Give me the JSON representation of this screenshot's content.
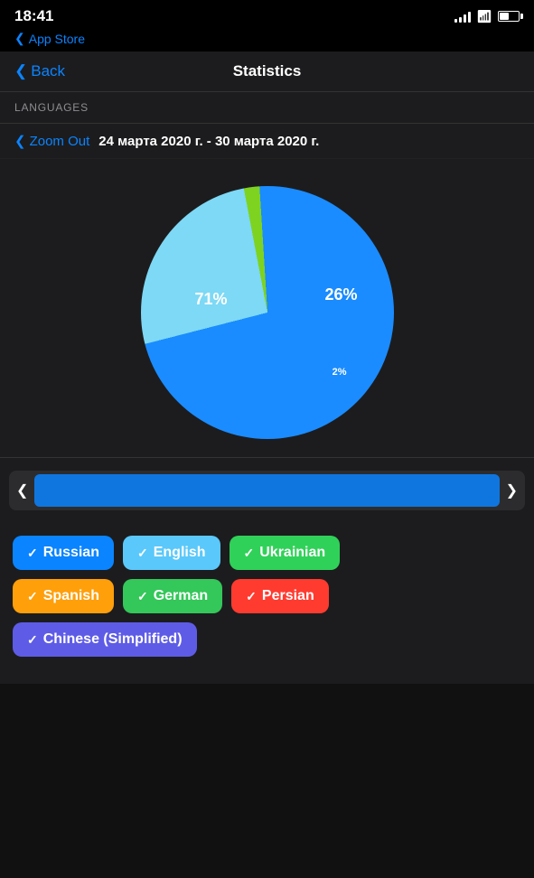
{
  "statusBar": {
    "time": "18:41",
    "appStore": "App Store"
  },
  "nav": {
    "back": "Back",
    "title": "Statistics"
  },
  "section": {
    "label": "LANGUAGES"
  },
  "zoom": {
    "button": "Zoom Out",
    "dateRange": "24 марта 2020 г. - 30 марта 2020 г."
  },
  "chart": {
    "segments": [
      {
        "label": "71%",
        "color": "#1a8cff",
        "percentage": 71
      },
      {
        "label": "26%",
        "color": "#7dd9f5",
        "percentage": 26
      },
      {
        "label": "2%",
        "color": "#7ed321",
        "percentage": 2
      },
      {
        "label": "",
        "color": "#1a8cff",
        "percentage": 1
      }
    ]
  },
  "tags": [
    {
      "label": "Russian",
      "color": "blue",
      "class": "tag-blue"
    },
    {
      "label": "English",
      "color": "light-blue",
      "class": "tag-light-blue"
    },
    {
      "label": "Ukrainian",
      "color": "green",
      "class": "tag-green"
    },
    {
      "label": "Spanish",
      "color": "orange",
      "class": "tag-orange"
    },
    {
      "label": "German",
      "color": "dark-green",
      "class": "tag-dark-green"
    },
    {
      "label": "Persian",
      "color": "red",
      "class": "tag-red"
    },
    {
      "label": "Chinese (Simplified)",
      "color": "purple",
      "class": "tag-purple"
    }
  ],
  "icons": {
    "check": "✓",
    "chevronLeft": "‹",
    "chevronRight": "›"
  }
}
